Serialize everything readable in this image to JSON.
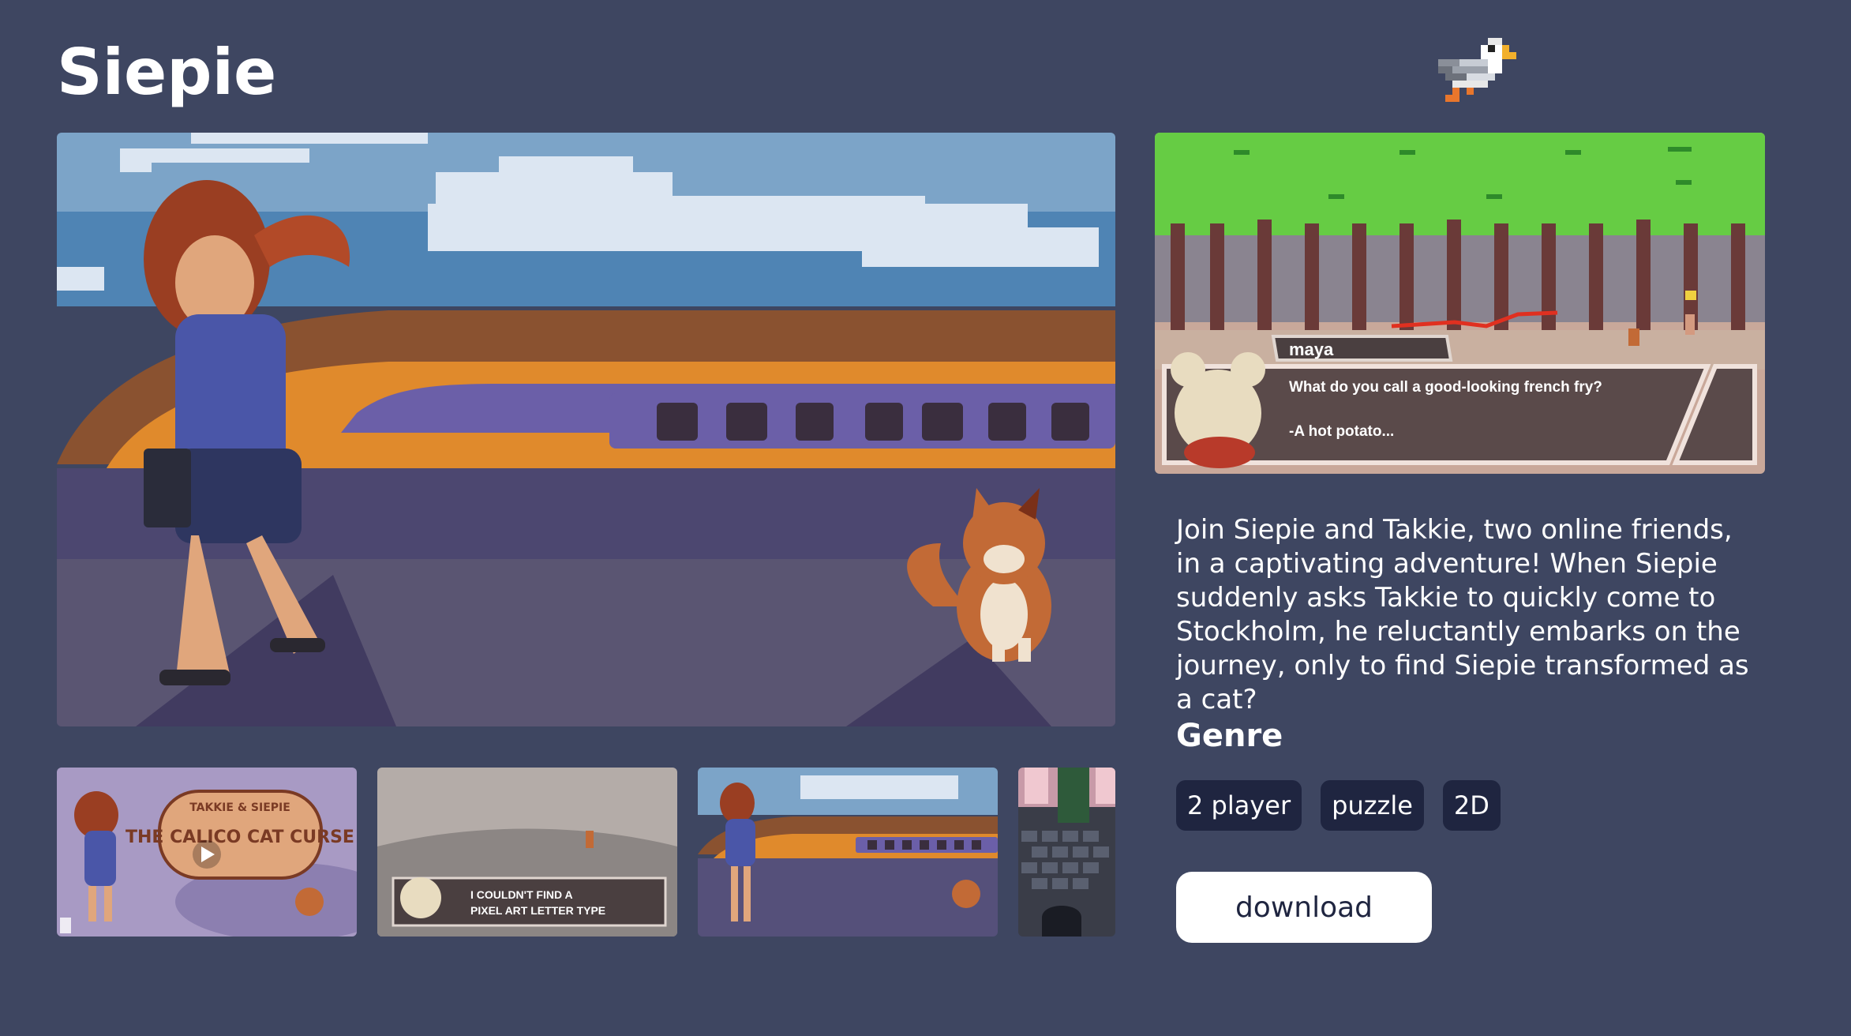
{
  "game": {
    "title": "Siepie"
  },
  "logo": {
    "icon": "pixel-seagull-icon"
  },
  "main_media": {
    "alt": ""
  },
  "thumbnails": [
    {
      "kind": "video",
      "logo_text_top": "TAKKIE & SIEPIE",
      "logo_text_main": "THE CALICO CAT CURSE",
      "icon": "play-icon"
    },
    {
      "kind": "image",
      "dialog_line1": "I COULDN'T FIND A",
      "dialog_line2": "PIXEL ART LETTER TYPE"
    },
    {
      "kind": "image"
    },
    {
      "kind": "image"
    }
  ],
  "screenshot": {
    "speaker": "maya",
    "line1": "What do you call a good-looking french fry?",
    "line2": "-A hot potato..."
  },
  "description": "Join Siepie and Takkie, two online friends, in a captivating adventure! When Siepie suddenly asks Takkie to quickly come to Stockholm, he reluctantly embarks on the journey, only to find Siepie transformed as a cat?",
  "genre": {
    "heading": "Genre",
    "tags": [
      "2 player",
      "puzzle",
      "2D"
    ]
  },
  "download": {
    "label": "download"
  },
  "colors": {
    "background": "#3e4661",
    "tag_bg": "#1f2540",
    "button_bg": "#ffffff",
    "train_orange": "#e08a2c",
    "train_purple": "#6b5fa8"
  }
}
